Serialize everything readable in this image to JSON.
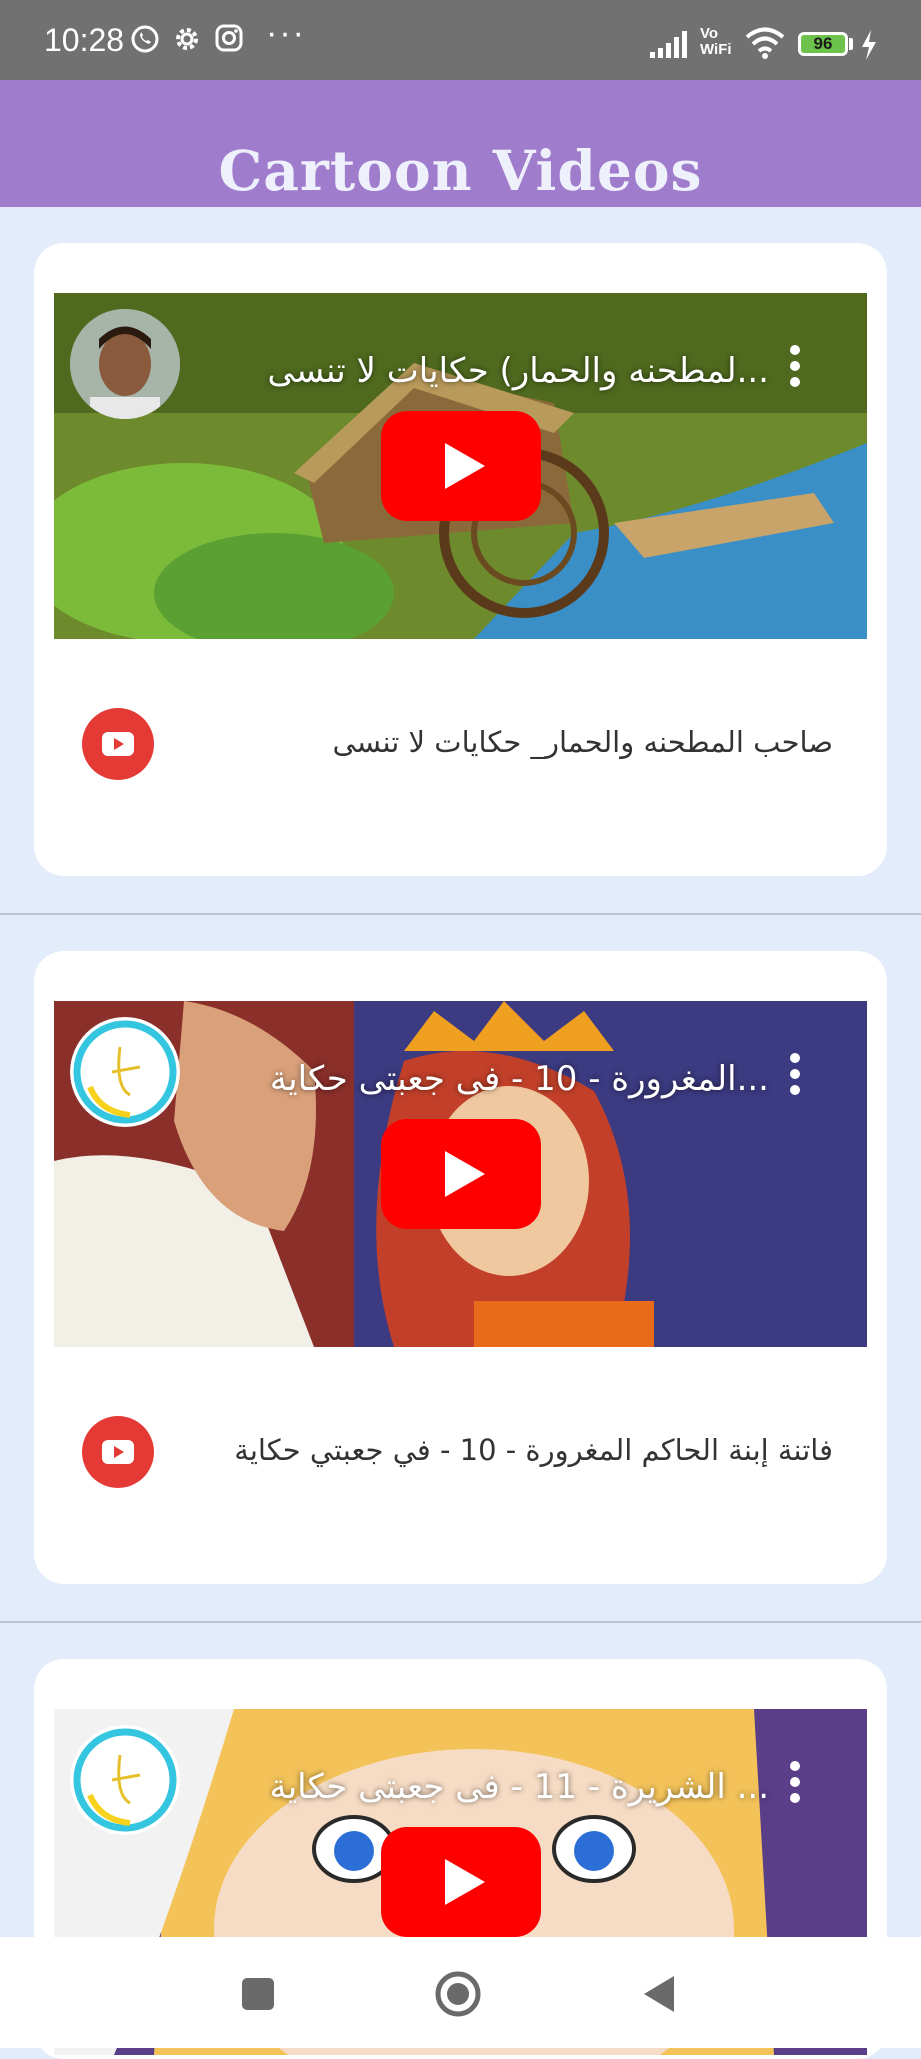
{
  "status_bar": {
    "time": "10:28",
    "icons": [
      "whatsapp-icon",
      "gear-icon",
      "instagram-icon",
      "more-dots-icon",
      "signal-icon",
      "vowifi-icon",
      "wifi-icon",
      "battery-icon",
      "charging-icon"
    ],
    "dots": "···",
    "vowifi_label": "Vo WiFi",
    "battery_level": "96"
  },
  "app_bar": {
    "title": "Cartoon Videos",
    "color": "#a07ccc"
  },
  "videos": [
    {
      "thumbnail_title": "...لمطحنه والحمار) حكايات لا تنسى",
      "caption": "صاحب المطحنه والحمار_ حكايات لا تنسى"
    },
    {
      "thumbnail_title": "...المغرورة - 10 - فى جعبتى حكاية",
      "caption": "فاتنة إبنة الحاكم المغرورة - 10 - في جعبتي حكاية"
    },
    {
      "thumbnail_title": "... الشريرة - 11 - فى جعبتى حكاية",
      "caption": ""
    }
  ],
  "nav_bar": {
    "icons": [
      "recents-square-icon",
      "home-circle-icon",
      "back-triangle-icon"
    ]
  },
  "colors": {
    "youtube_red": "#e53935",
    "background": "#e3ecfb"
  }
}
